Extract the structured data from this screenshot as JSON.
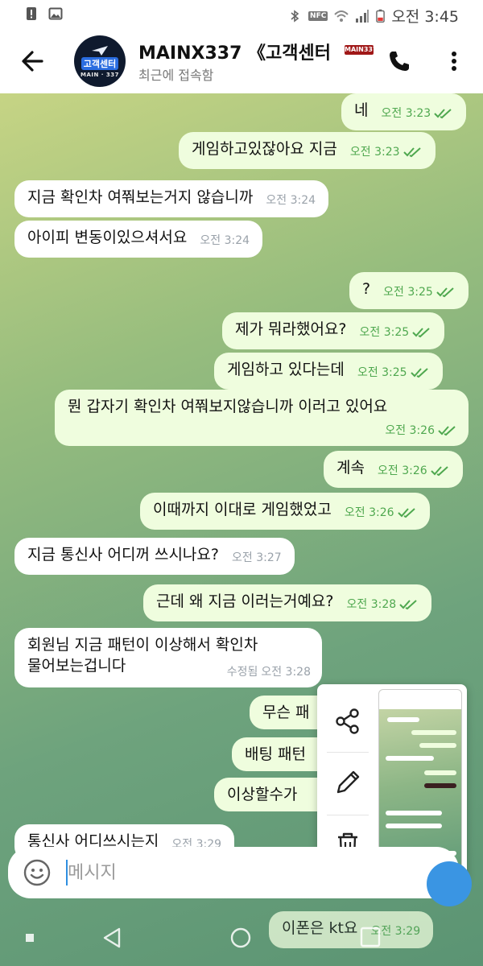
{
  "status_bar": {
    "time": "오전 3:45",
    "left_icons": [
      "alert-icon",
      "image-icon"
    ],
    "right_icons": [
      "bluetooth-icon",
      "nfc-icon",
      "wifi-icon",
      "signal-icon",
      "battery-icon"
    ],
    "nfc_label": "NFC"
  },
  "header": {
    "title": "MAINX337 《고객센터",
    "subtitle": "최근에 접속함",
    "avatar_title": "고객센터",
    "avatar_sub": "MAIN · 337",
    "badge_text": "MAIN337"
  },
  "messages": [
    {
      "dir": "out",
      "text": "네",
      "time": "오전 3:23",
      "read": true
    },
    {
      "dir": "out",
      "text": "게임하고있잖아요 지금",
      "time": "오전 3:23",
      "read": true
    },
    {
      "dir": "in",
      "text": "지금 확인차 여쭤보는거지 않습니까",
      "time": "오전 3:24"
    },
    {
      "dir": "in",
      "text": "아이피 변동이있으셔서요",
      "time": "오전 3:24"
    },
    {
      "dir": "out",
      "text": "?",
      "time": "오전 3:25",
      "read": true
    },
    {
      "dir": "out",
      "text": "제가 뭐라했어요?",
      "time": "오전 3:25",
      "read": true
    },
    {
      "dir": "out",
      "text": "게임하고 있다는데",
      "time": "오전 3:25",
      "read": true
    },
    {
      "dir": "out",
      "text": "뭔 갑자기 확인차 여쭤보지않습니까 이러고 있어요",
      "time": "오전 3:26",
      "read": true
    },
    {
      "dir": "out",
      "text": "계속",
      "time": "오전 3:26",
      "read": true
    },
    {
      "dir": "out",
      "text": "이때까지 이대로 게임했었고",
      "time": "오전 3:26",
      "read": true
    },
    {
      "dir": "in",
      "text": "지금 통신사 어디꺼 쓰시나요?",
      "time": "오전 3:27"
    },
    {
      "dir": "out",
      "text": "근데 왜 지금 이러는거예요?",
      "time": "오전 3:28",
      "read": true
    },
    {
      "dir": "in",
      "text_line1": "회원님 지금 패턴이 이상해서 확인차",
      "text_line2": "물어보는겁니다",
      "edited": "수정됨",
      "time": "오전 3:28"
    },
    {
      "dir": "out",
      "text": "무슨 패",
      "partial": true
    },
    {
      "dir": "out",
      "text": "배팅 패턴",
      "partial": true
    },
    {
      "dir": "out",
      "text": "이상할수가",
      "partial": true
    },
    {
      "dir": "in",
      "text": "통신사 어디쓰시는지",
      "time": "오전 3:29",
      "partial": true
    },
    {
      "dir": "out",
      "text": "이폰은 kt요",
      "time": "오전 3:29",
      "partial": true
    }
  ],
  "share_menu": {
    "items": [
      "share-icon",
      "edit-icon",
      "delete-icon"
    ]
  },
  "input": {
    "placeholder": "메시지"
  },
  "nav": {
    "items": [
      "nav-dot",
      "nav-back-icon",
      "nav-home-icon",
      "nav-recents-icon"
    ]
  },
  "colors": {
    "outgoing_bubble": "#effdde",
    "incoming_bubble": "#ffffff",
    "read_check": "#4fa84f",
    "accent": "#3a95e3"
  }
}
